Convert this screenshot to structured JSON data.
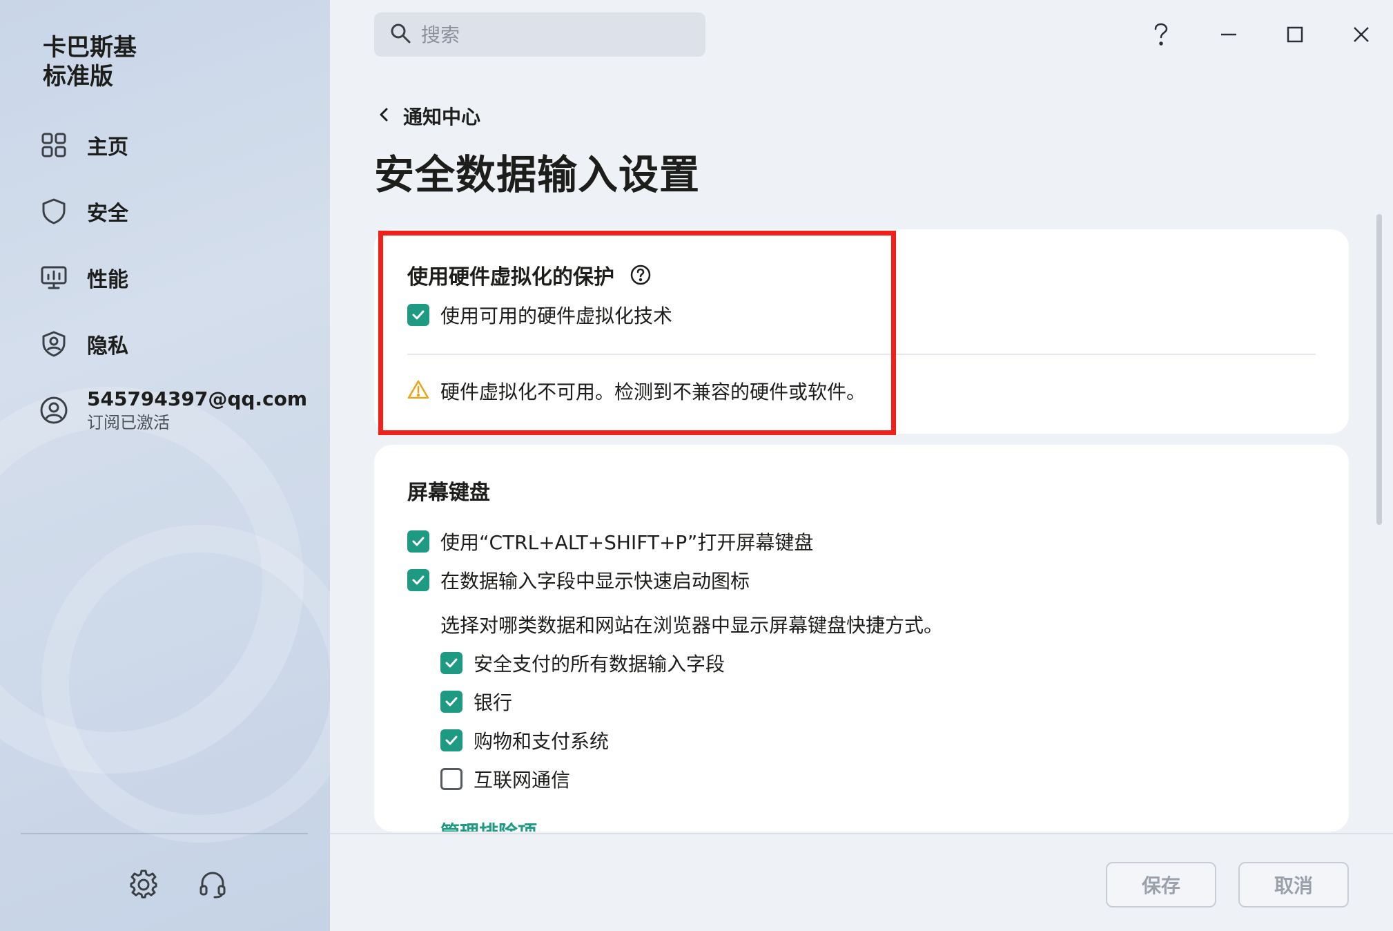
{
  "app": {
    "title_line1": "卡巴斯基",
    "title_line2": "标准版"
  },
  "sidebar": {
    "items": [
      {
        "label": "主页",
        "icon": "grid-icon"
      },
      {
        "label": "安全",
        "icon": "shield-icon"
      },
      {
        "label": "性能",
        "icon": "monitor-icon"
      },
      {
        "label": "隐私",
        "icon": "privacy-shield-icon"
      }
    ],
    "account": {
      "email": "545794397@qq.com",
      "status": "订阅已激活",
      "icon": "user-icon"
    },
    "bottom_icons": [
      "gear-icon",
      "headset-icon"
    ]
  },
  "search": {
    "placeholder": "搜索",
    "value": ""
  },
  "window_controls": [
    "help-icon",
    "minimize-icon",
    "maximize-icon",
    "close-icon"
  ],
  "breadcrumb": {
    "back_label": "通知中心"
  },
  "page_title": "安全数据输入设置",
  "hardware_section": {
    "title": "使用硬件虚拟化的保护",
    "checkbox_label": "使用可用的硬件虚拟化技术",
    "checkbox_checked": true,
    "warning_text": "硬件虚拟化不可用。检测到不兼容的硬件或软件。"
  },
  "keyboard_section": {
    "title": "屏幕键盘",
    "options": [
      {
        "label": "使用“CTRL+ALT+SHIFT+P”打开屏幕键盘",
        "checked": true
      },
      {
        "label": "在数据输入字段中显示快速启动图标",
        "checked": true
      }
    ],
    "description": "选择对哪类数据和网站在浏览器中显示屏幕键盘快捷方式。",
    "sub_options": [
      {
        "label": "安全支付的所有数据输入字段",
        "checked": true
      },
      {
        "label": "银行",
        "checked": true
      },
      {
        "label": "购物和支付系统",
        "checked": true
      },
      {
        "label": "互联网通信",
        "checked": false
      }
    ],
    "link_label": "管理排除项"
  },
  "footer": {
    "save_label": "保存",
    "cancel_label": "取消"
  },
  "colors": {
    "accent": "#1e9a82",
    "highlight": "#f0201a",
    "warning": "#e8a317"
  }
}
